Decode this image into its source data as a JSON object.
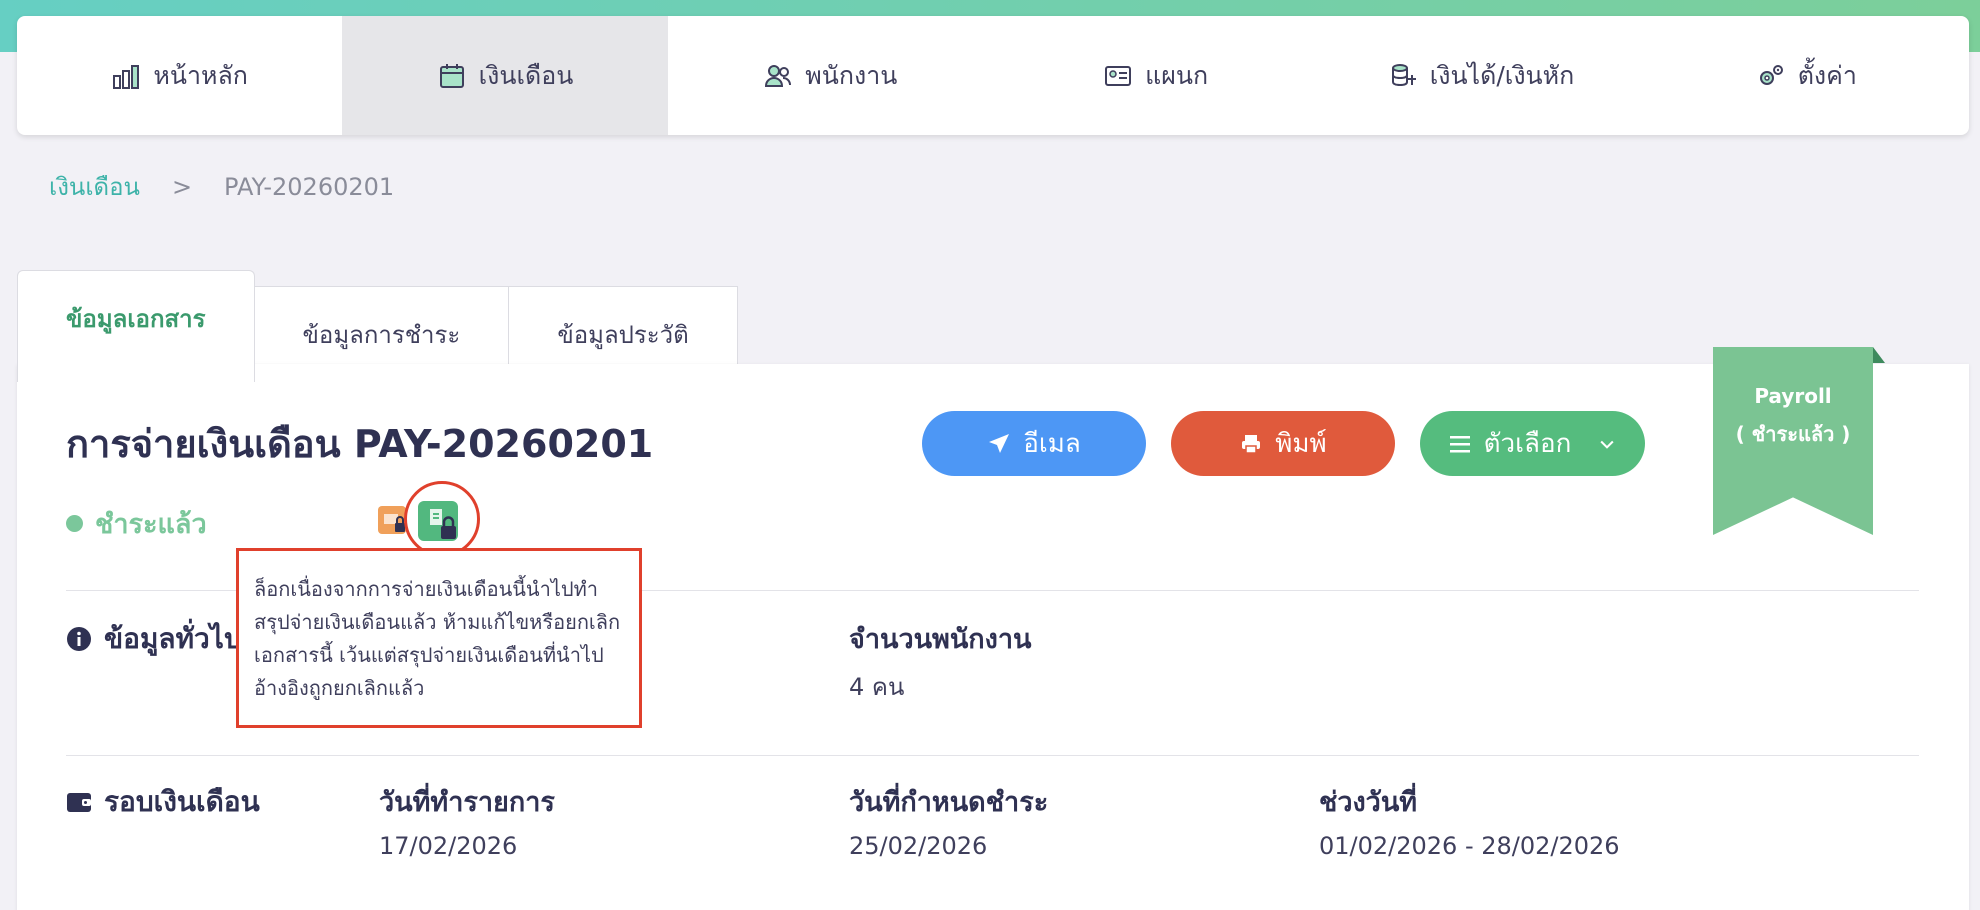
{
  "nav": {
    "items": [
      {
        "label": "หน้าหลัก",
        "icon": "bar-chart-icon"
      },
      {
        "label": "เงินเดือน",
        "icon": "calendar-icon",
        "active": true
      },
      {
        "label": "พนักงาน",
        "icon": "users-icon"
      },
      {
        "label": "แผนก",
        "icon": "id-card-icon"
      },
      {
        "label": "เงินได้/เงินหัก",
        "icon": "coins-icon"
      },
      {
        "label": "ตั้งค่า",
        "icon": "gears-icon"
      }
    ]
  },
  "breadcrumb": {
    "link": "เงินเดือน",
    "separator": ">",
    "current": "PAY-20260201"
  },
  "tabs": [
    "ข้อมูลเอกสาร",
    "ข้อมูลการชำระ",
    "ข้อมูลประวัติ"
  ],
  "document": {
    "title": "การจ่ายเงินเดือน PAY-20260201",
    "status": "ชำระแล้ว"
  },
  "buttons": {
    "email": "อีเมล",
    "print": "พิมพ์",
    "options": "ตัวเลือก"
  },
  "ribbon": {
    "line1": "Payroll",
    "line2": "( ชำระแล้ว )"
  },
  "tooltip": {
    "text": "ล็อกเนื่องจากการจ่ายเงินเดือนนี้นำไปทำสรุปจ่ายเงินเดือนแล้ว ห้ามแก้ไขหรือยกเลิกเอกสารนี้ เว้นแต่สรุปจ่ายเงินเดือนที่นำไปอ้างอิงถูกยกเลิกแล้ว"
  },
  "general": {
    "heading": "ข้อมูลทั่วไป",
    "employee_count_label": "จำนวนพนักงาน",
    "employee_count_value": "4 คน"
  },
  "payroll_cycle": {
    "heading": "รอบเงินเดือน",
    "transaction_date_label": "วันที่ทำรายการ",
    "transaction_date_value": "17/02/2026",
    "due_date_label": "วันที่กำหนดชำระ",
    "due_date_value": "25/02/2026",
    "date_range_label": "ช่วงวันที่",
    "date_range_value": "01/02/2026 - 28/02/2026"
  },
  "colors": {
    "accent": "#3eb3a9",
    "email": "#4d97f5",
    "print": "#e05a3c",
    "options": "#55bc7e",
    "paid": "#7bc79b",
    "highlight": "#e0402c"
  }
}
